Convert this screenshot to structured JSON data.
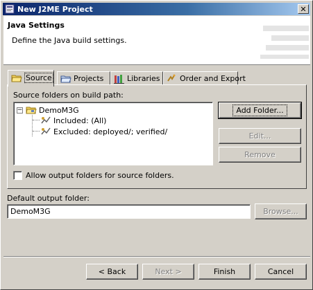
{
  "window": {
    "title": "New J2ME Project",
    "close_label": "✕"
  },
  "header": {
    "title": "Java Settings",
    "description": "Define the Java build settings."
  },
  "tabs": [
    {
      "label": "Source",
      "icon": "source-folder-icon",
      "active": true
    },
    {
      "label": "Projects",
      "icon": "projects-icon",
      "active": false
    },
    {
      "label": "Libraries",
      "icon": "libraries-icon",
      "active": false
    },
    {
      "label": "Order and Export",
      "icon": "order-export-icon",
      "active": false
    }
  ],
  "source_tab": {
    "folders_label": "Source folders on build path:",
    "tree": {
      "root": {
        "label": "DemoM3G",
        "expanded": true,
        "expander": "−"
      },
      "children": [
        {
          "label": "Included: (All)"
        },
        {
          "label": "Excluded: deployed/; verified/"
        }
      ]
    },
    "buttons": {
      "add_folder": "Add Folder...",
      "edit": "Edit...",
      "remove": "Remove"
    },
    "allow_output_checkbox": {
      "label": "Allow output folders for source folders.",
      "checked": false
    }
  },
  "output": {
    "label": "Default output folder:",
    "value": "DemoM3G",
    "browse_label": "Browse..."
  },
  "footer": {
    "back": "< Back",
    "next": "Next >",
    "finish": "Finish",
    "cancel": "Cancel"
  }
}
